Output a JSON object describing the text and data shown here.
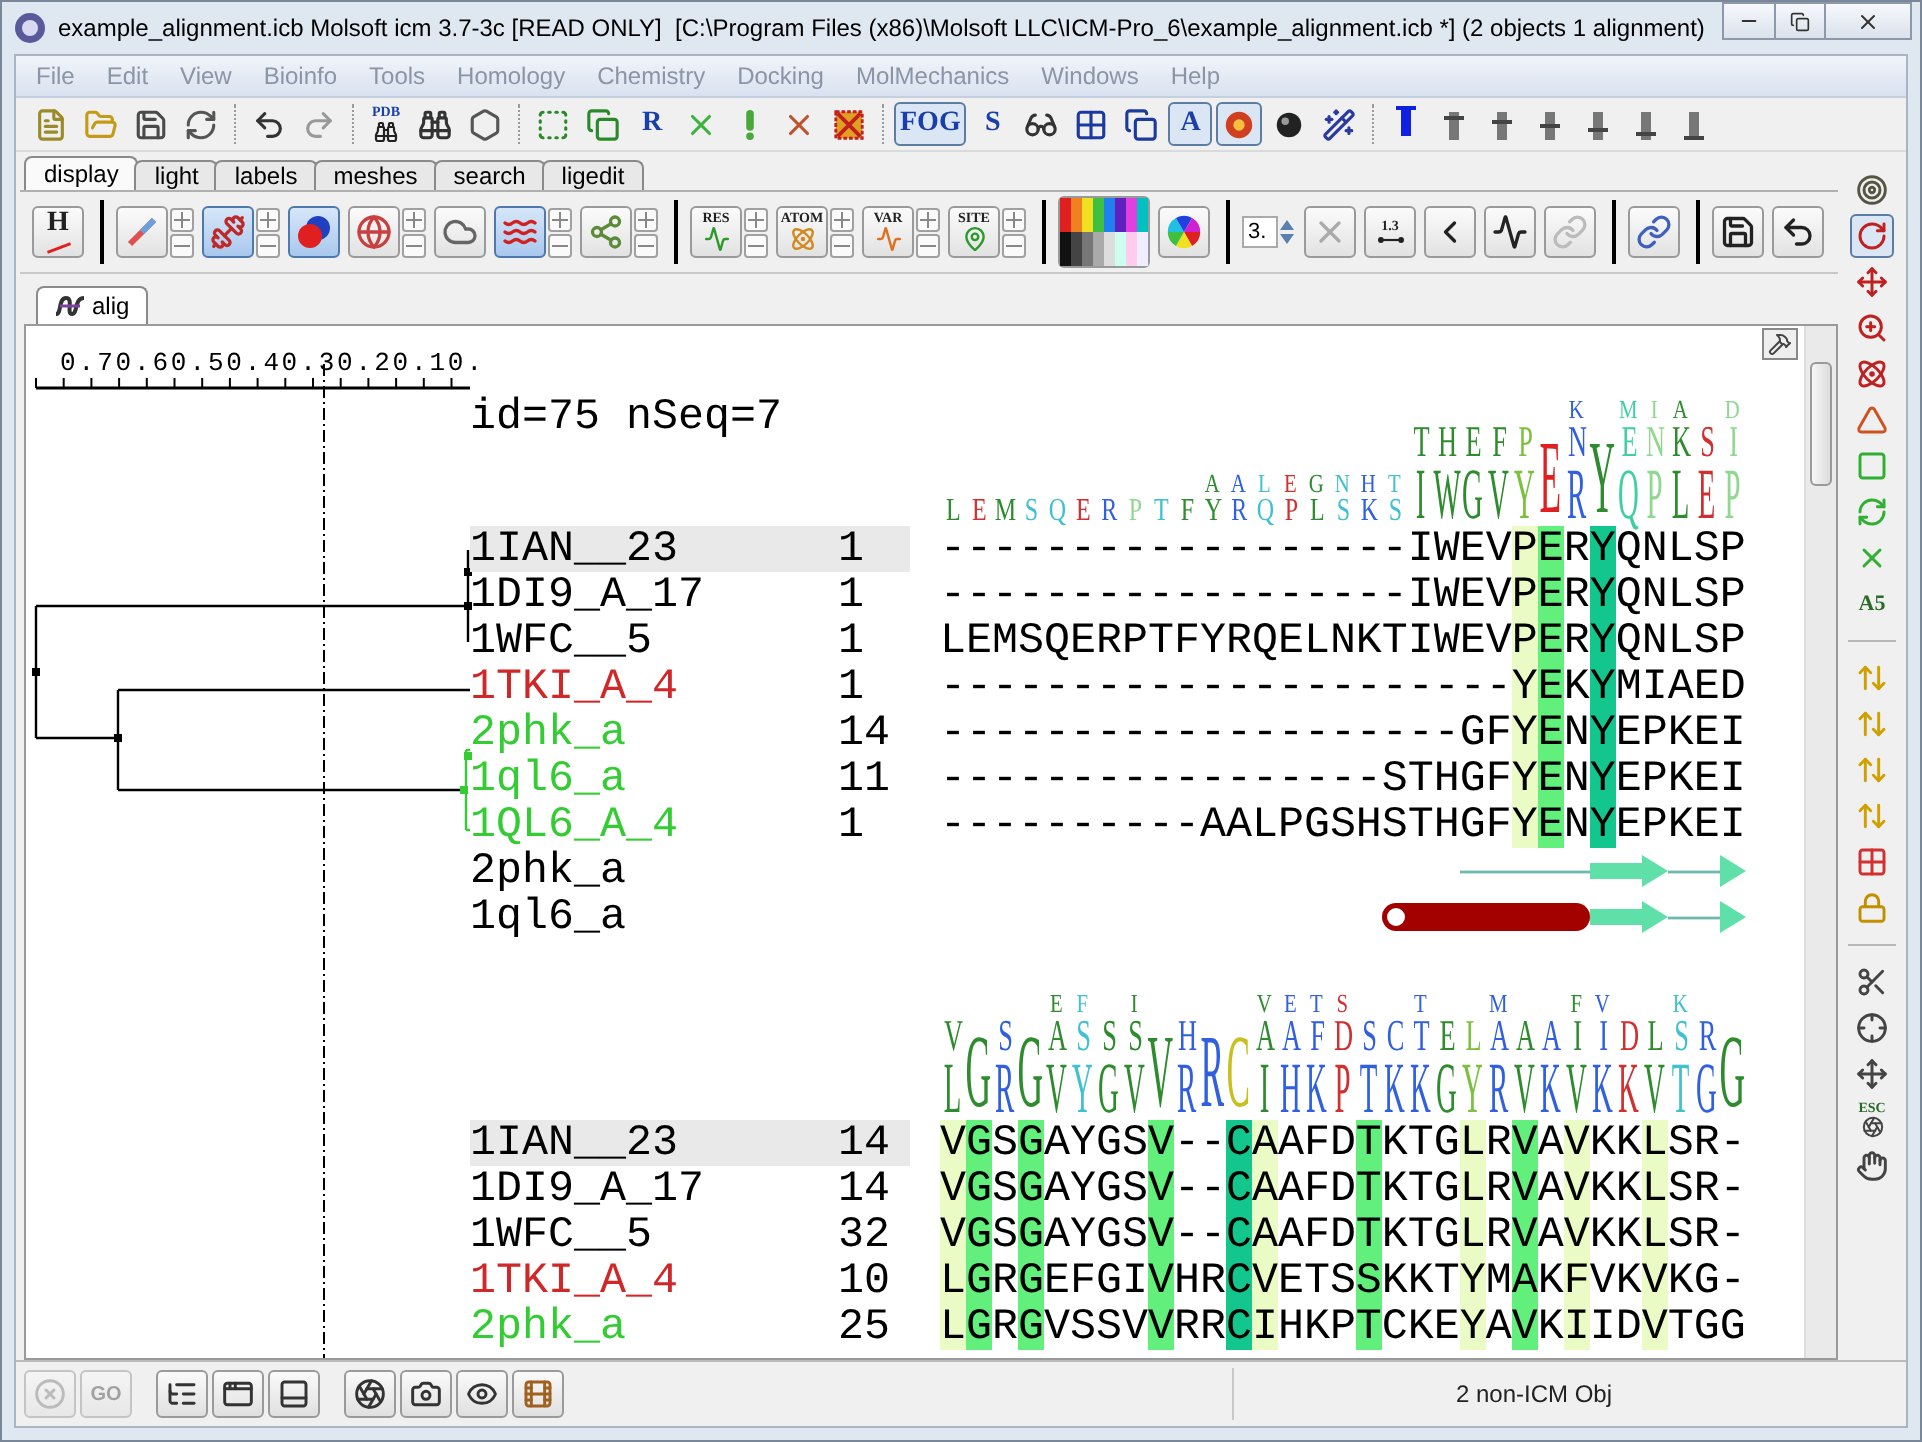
{
  "window": {
    "title": "example_alignment.icb Molsoft icm 3.7-3c [READ ONLY]  [C:\\Program Files (x86)\\Molsoft LLC\\ICM-Pro_6\\example_alignment.icb *] (2 objects 1 alignment)"
  },
  "menu": [
    "File",
    "Edit",
    "View",
    "Bioinfo",
    "Tools",
    "Homology",
    "Chemistry",
    "Docking",
    "MolMechanics",
    "Windows",
    "Help"
  ],
  "main_toolbar": [
    [
      {
        "on": false
      },
      {
        "on": false
      },
      {
        "on": false
      },
      {
        "on": false
      }
    ],
    [
      {
        "on": false
      },
      {
        "on": false
      }
    ],
    [
      {
        "label": "PDB",
        "on": false
      },
      {
        "on": false
      },
      {
        "on": false
      }
    ],
    [
      {
        "on": false
      },
      {
        "on": false
      },
      {
        "label": "R",
        "on": false
      },
      {
        "on": false
      },
      {
        "on": false
      },
      {
        "on": false
      },
      {
        "on": false
      }
    ],
    [
      {
        "label": "FOG",
        "on": true
      },
      {
        "label": "S",
        "on": false
      },
      {
        "on": false
      },
      {
        "on": false
      },
      {
        "on": false
      },
      {
        "label": "A",
        "on": true
      },
      {
        "on": true
      },
      {
        "on": false
      },
      {
        "on": false
      }
    ],
    [
      {
        "on": true
      },
      {
        "on": false
      },
      {
        "on": false
      },
      {
        "on": false
      },
      {
        "on": false
      },
      {
        "on": false
      },
      {
        "on": false
      }
    ]
  ],
  "tabs": [
    {
      "label": "display",
      "selected": true
    },
    {
      "label": "light",
      "selected": false
    },
    {
      "label": "labels",
      "selected": false
    },
    {
      "label": "meshes",
      "selected": false
    },
    {
      "label": "search",
      "selected": false
    },
    {
      "label": "ligedit",
      "selected": false
    }
  ],
  "display_toolbar": [
    [
      {
        "kind": "button",
        "label": "H",
        "on": false,
        "steppers": false
      }
    ],
    [
      {
        "kind": "button",
        "on": false,
        "steppers": true
      },
      {
        "kind": "button",
        "on": true,
        "steppers": true
      },
      {
        "kind": "button",
        "on": true,
        "steppers": false
      },
      {
        "kind": "button",
        "on": false,
        "steppers": true
      },
      {
        "kind": "button",
        "on": false,
        "steppers": false
      },
      {
        "kind": "button",
        "on": true,
        "steppers": true
      },
      {
        "kind": "button",
        "on": false,
        "steppers": true
      }
    ],
    [
      {
        "kind": "button",
        "label": "RES",
        "on": false,
        "steppers": true
      },
      {
        "kind": "button",
        "label": "ATOM",
        "on": false,
        "steppers": true
      },
      {
        "kind": "button",
        "label": "VAR",
        "on": false,
        "steppers": true
      },
      {
        "kind": "button",
        "label": "SITE",
        "on": false,
        "steppers": true
      }
    ],
    [
      {
        "kind": "button",
        "on": false,
        "steppers": false
      },
      {
        "kind": "button",
        "on": false,
        "steppers": false
      }
    ],
    [
      {
        "kind": "spin",
        "value": "3."
      },
      {
        "kind": "button",
        "on": false,
        "steppers": false
      },
      {
        "kind": "button",
        "label": "1.3",
        "on": false,
        "steppers": false
      },
      {
        "kind": "button",
        "on": false,
        "steppers": false
      },
      {
        "kind": "button",
        "on": false,
        "steppers": false
      },
      {
        "kind": "button",
        "on": false,
        "steppers": false
      }
    ],
    [
      {
        "kind": "button",
        "on": false,
        "steppers": false
      }
    ],
    [
      {
        "kind": "button",
        "on": false,
        "steppers": false
      },
      {
        "kind": "button",
        "on": false,
        "steppers": false
      }
    ]
  ],
  "document_tab": {
    "label": "alig",
    "selected": true
  },
  "ruler": {
    "ticks": [
      "0.7",
      "0.6",
      "0.5",
      "0.4",
      "0.3",
      "0.2",
      "0.1",
      "0."
    ]
  },
  "alignment": {
    "header": "id=75 nSeq=7",
    "blocks": [
      {
        "logo": [
          {
            "letters": "L",
            "color": "#2e8b2e",
            "kind": "short"
          },
          {
            "letters": "E",
            "color": "#d03030",
            "kind": "short"
          },
          {
            "letters": "M",
            "color": "#2e8b2e",
            "kind": "short"
          },
          {
            "letters": "S",
            "color": "#40c0d0",
            "kind": "short"
          },
          {
            "letters": "Q",
            "color": "#40c0d0",
            "kind": "short"
          },
          {
            "letters": "E",
            "color": "#d03030",
            "kind": "short"
          },
          {
            "letters": "R",
            "color": "#3060e0",
            "kind": "short"
          },
          {
            "letters": "P",
            "color": "#90d890",
            "kind": "short"
          },
          {
            "letters": "T",
            "color": "#40c0d0",
            "kind": "short"
          },
          {
            "letters": "F",
            "color": "#2e8b2e",
            "kind": "short"
          },
          {
            "letters": "AY",
            "color": "#2e8b2e",
            "kind": "short"
          },
          {
            "letters": "AR",
            "color": "#3060e0",
            "kind": "short"
          },
          {
            "letters": "LQ",
            "color": "#40c0d0",
            "kind": "short"
          },
          {
            "letters": "EP",
            "color": "#d03030",
            "kind": "short"
          },
          {
            "letters": "GL",
            "color": "#2e8b2e",
            "kind": "short"
          },
          {
            "letters": "NS",
            "color": "#40c0d0",
            "kind": "short"
          },
          {
            "letters": "HK",
            "color": "#3060e0",
            "kind": "short"
          },
          {
            "letters": "TS",
            "color": "#40c0d0",
            "kind": "short"
          },
          {
            "letters": "TI",
            "color": "#2e8b2e",
            "kind": "tall"
          },
          {
            "letters": "HW",
            "color": "#2e8b2e",
            "kind": "tall"
          },
          {
            "letters": "EG",
            "color": "#2e8b2e",
            "kind": "tall"
          },
          {
            "letters": "FV",
            "color": "#2e8b2e",
            "kind": "tall"
          },
          {
            "letters": "PY",
            "color": "#7cc040",
            "kind": "tall"
          },
          {
            "letters": "E",
            "color": "#e02020",
            "kind": "tall"
          },
          {
            "letters": "KNR",
            "color": "#3060e0",
            "kind": "tall"
          },
          {
            "letters": "Y",
            "color": "#2e8b2e",
            "kind": "tall"
          },
          {
            "letters": "MEQ",
            "color": "#40d0a0",
            "kind": "tall"
          },
          {
            "letters": "INP",
            "color": "#90d890",
            "kind": "tall"
          },
          {
            "letters": "AKL",
            "color": "#2e8b2e",
            "kind": "tall"
          },
          {
            "letters": "SE",
            "color": "#d03030",
            "kind": "tall"
          },
          {
            "letters": "DIP",
            "color": "#90d890",
            "kind": "tall"
          }
        ],
        "columns": [
          {
            "kind": "none"
          },
          {
            "kind": "none"
          },
          {
            "kind": "none"
          },
          {
            "kind": "none"
          },
          {
            "kind": "none"
          },
          {
            "kind": "none"
          },
          {
            "kind": "none"
          },
          {
            "kind": "none"
          },
          {
            "kind": "none"
          },
          {
            "kind": "none"
          },
          {
            "kind": "none"
          },
          {
            "kind": "none"
          },
          {
            "kind": "none"
          },
          {
            "kind": "none"
          },
          {
            "kind": "none"
          },
          {
            "kind": "none"
          },
          {
            "kind": "none"
          },
          {
            "kind": "none"
          },
          {
            "kind": "none"
          },
          {
            "kind": "none"
          },
          {
            "kind": "none"
          },
          {
            "kind": "none"
          },
          {
            "kind": "light"
          },
          {
            "kind": "green"
          },
          {
            "kind": "none"
          },
          {
            "kind": "teal"
          },
          {
            "kind": "none"
          },
          {
            "kind": "none"
          },
          {
            "kind": "none"
          },
          {
            "kind": "none"
          },
          {
            "kind": "none"
          }
        ],
        "rows": [
          {
            "name": "1IAN__23",
            "start": "1",
            "sequence": "------------------IWEVPERYQNLSP",
            "color": "#000000",
            "selected": true
          },
          {
            "name": "1DI9_A_17",
            "start": "1",
            "sequence": "------------------IWEVPERYQNLSP",
            "color": "#000000",
            "selected": false
          },
          {
            "name": "1WFC__5",
            "start": "1",
            "sequence": "LEMSQERPTFYRQELNKTIWEVPERYQNLSP",
            "color": "#000000",
            "selected": false
          },
          {
            "name": "1TKI_A_4",
            "start": "1",
            "sequence": "----------------------YEKYMIAED",
            "color": "#d02828",
            "selected": false
          },
          {
            "name": "2phk_a",
            "start": "14",
            "sequence": "--------------------GFYENYEPKEI",
            "color": "#33cc33",
            "selected": false
          },
          {
            "name": "1ql6_a",
            "start": "11",
            "sequence": "-----------------STHGFYENYEPKEI",
            "color": "#33cc33",
            "selected": false
          },
          {
            "name": "1QL6_A_4",
            "start": "1",
            "sequence": "----------AALPGSHSTHGFYENYEPKEI",
            "color": "#33cc33",
            "selected": false
          }
        ],
        "structure_rows": [
          {
            "name": "2phk_a",
            "segments": [
              {
                "kind": "none"
              },
              {
                "kind": "none"
              },
              {
                "kind": "none"
              },
              {
                "kind": "none"
              },
              {
                "kind": "none"
              },
              {
                "kind": "none"
              },
              {
                "kind": "none"
              },
              {
                "kind": "none"
              },
              {
                "kind": "none"
              },
              {
                "kind": "none"
              },
              {
                "kind": "none"
              },
              {
                "kind": "none"
              },
              {
                "kind": "none"
              },
              {
                "kind": "none"
              },
              {
                "kind": "none"
              },
              {
                "kind": "none"
              },
              {
                "kind": "none"
              },
              {
                "kind": "none"
              },
              {
                "kind": "none"
              },
              {
                "kind": "none"
              },
              {
                "kind": "coil"
              },
              {
                "kind": "coil"
              },
              {
                "kind": "coil"
              },
              {
                "kind": "coil"
              },
              {
                "kind": "coil"
              },
              {
                "kind": "strand"
              },
              {
                "kind": "strand"
              },
              {
                "kind": "strand"
              },
              {
                "kind": "coil"
              },
              {
                "kind": "coil"
              },
              {
                "kind": "strand"
              }
            ]
          },
          {
            "name": "1ql6_a",
            "segments": [
              {
                "kind": "none"
              },
              {
                "kind": "none"
              },
              {
                "kind": "none"
              },
              {
                "kind": "none"
              },
              {
                "kind": "none"
              },
              {
                "kind": "none"
              },
              {
                "kind": "none"
              },
              {
                "kind": "none"
              },
              {
                "kind": "none"
              },
              {
                "kind": "none"
              },
              {
                "kind": "none"
              },
              {
                "kind": "none"
              },
              {
                "kind": "none"
              },
              {
                "kind": "none"
              },
              {
                "kind": "none"
              },
              {
                "kind": "none"
              },
              {
                "kind": "none"
              },
              {
                "kind": "helix"
              },
              {
                "kind": "helix"
              },
              {
                "kind": "helix"
              },
              {
                "kind": "helix"
              },
              {
                "kind": "helix"
              },
              {
                "kind": "helix"
              },
              {
                "kind": "helix"
              },
              {
                "kind": "helix"
              },
              {
                "kind": "strand"
              },
              {
                "kind": "strand"
              },
              {
                "kind": "strand"
              },
              {
                "kind": "coil"
              },
              {
                "kind": "coil"
              },
              {
                "kind": "strand"
              }
            ]
          }
        ]
      },
      {
        "logo": [
          {
            "letters": "VL",
            "color": "#2e8b2e",
            "kind": "tall"
          },
          {
            "letters": "G",
            "color": "#2e8b2e",
            "kind": "tall"
          },
          {
            "letters": "SR",
            "color": "#3060e0",
            "kind": "tall"
          },
          {
            "letters": "G",
            "color": "#2e8b2e",
            "kind": "tall"
          },
          {
            "letters": "EAV",
            "color": "#2e8b2e",
            "kind": "tall"
          },
          {
            "letters": "FSY",
            "color": "#40c0d0",
            "kind": "tall"
          },
          {
            "letters": "SG",
            "color": "#2e8b2e",
            "kind": "tall"
          },
          {
            "letters": "ISV",
            "color": "#2e8b2e",
            "kind": "tall"
          },
          {
            "letters": "V",
            "color": "#2e8b2e",
            "kind": "tall"
          },
          {
            "letters": "HR",
            "color": "#3060e0",
            "kind": "tall"
          },
          {
            "letters": "R",
            "color": "#3060e0",
            "kind": "tall"
          },
          {
            "letters": "C",
            "color": "#c8c020",
            "kind": "tall"
          },
          {
            "letters": "VAI",
            "color": "#2e8b2e",
            "kind": "tall"
          },
          {
            "letters": "EAH",
            "color": "#3060e0",
            "kind": "tall"
          },
          {
            "letters": "TFK",
            "color": "#3060e0",
            "kind": "tall"
          },
          {
            "letters": "SDP",
            "color": "#d03030",
            "kind": "tall"
          },
          {
            "letters": "ST",
            "color": "#3060e0",
            "kind": "tall"
          },
          {
            "letters": "CK",
            "color": "#3060e0",
            "kind": "tall"
          },
          {
            "letters": "TTK",
            "color": "#3060e0",
            "kind": "tall"
          },
          {
            "letters": "EG",
            "color": "#2e8b2e",
            "kind": "tall"
          },
          {
            "letters": "LY",
            "color": "#7cc040",
            "kind": "tall"
          },
          {
            "letters": "MAR",
            "color": "#3060e0",
            "kind": "tall"
          },
          {
            "letters": "AV",
            "color": "#2e8b2e",
            "kind": "tall"
          },
          {
            "letters": "AK",
            "color": "#3060e0",
            "kind": "tall"
          },
          {
            "letters": "FIV",
            "color": "#2e8b2e",
            "kind": "tall"
          },
          {
            "letters": "VIK",
            "color": "#3060e0",
            "kind": "tall"
          },
          {
            "letters": "DK",
            "color": "#d03030",
            "kind": "tall"
          },
          {
            "letters": "LV",
            "color": "#2e8b2e",
            "kind": "tall"
          },
          {
            "letters": "KST",
            "color": "#40c0d0",
            "kind": "tall"
          },
          {
            "letters": "RG",
            "color": "#3060e0",
            "kind": "tall"
          },
          {
            "letters": "G",
            "color": "#2e8b2e",
            "kind": "tall"
          }
        ],
        "columns": [
          {
            "kind": "light"
          },
          {
            "kind": "green"
          },
          {
            "kind": "none"
          },
          {
            "kind": "green"
          },
          {
            "kind": "none"
          },
          {
            "kind": "none"
          },
          {
            "kind": "none"
          },
          {
            "kind": "none"
          },
          {
            "kind": "green"
          },
          {
            "kind": "none"
          },
          {
            "kind": "none"
          },
          {
            "kind": "teal"
          },
          {
            "kind": "light"
          },
          {
            "kind": "none"
          },
          {
            "kind": "none"
          },
          {
            "kind": "none"
          },
          {
            "kind": "green"
          },
          {
            "kind": "none"
          },
          {
            "kind": "none"
          },
          {
            "kind": "none"
          },
          {
            "kind": "light"
          },
          {
            "kind": "none"
          },
          {
            "kind": "green"
          },
          {
            "kind": "none"
          },
          {
            "kind": "light"
          },
          {
            "kind": "none"
          },
          {
            "kind": "none"
          },
          {
            "kind": "light"
          },
          {
            "kind": "none"
          },
          {
            "kind": "none"
          },
          {
            "kind": "none"
          }
        ],
        "rows": [
          {
            "name": "1IAN__23",
            "start": "14",
            "sequence": "VGSGAYGSV--CAAFDTKTGLRVAVKKLSR-",
            "color": "#000000",
            "selected": true
          },
          {
            "name": "1DI9_A_17",
            "start": "14",
            "sequence": "VGSGAYGSV--CAAFDTKTGLRVAVKKLSR-",
            "color": "#000000",
            "selected": false
          },
          {
            "name": "1WFC__5",
            "start": "32",
            "sequence": "VGSGAYGSV--CAAFDTKTGLRVAVKKLSR-",
            "color": "#000000",
            "selected": false
          },
          {
            "name": "1TKI_A_4",
            "start": "10",
            "sequence": "LGRGEFGIVHRCVETSSKKTYMAKFVKVKG-",
            "color": "#d02828",
            "selected": false
          },
          {
            "name": "2phk_a",
            "start": "25",
            "sequence": "LGRGVSSVVRRCIHKPTCKEYAVKIIDVTGG",
            "color": "#33cc33",
            "selected": false
          }
        ]
      }
    ]
  },
  "right_toolbar": [
    [
      {
        "on": false
      },
      {
        "on": true
      },
      {
        "on": false
      },
      {
        "on": false
      },
      {
        "on": false
      },
      {
        "on": false
      },
      {
        "on": false
      },
      {
        "on": false
      },
      {
        "on": false
      },
      {
        "label": "A5",
        "on": false
      }
    ],
    [
      {
        "on": false
      },
      {
        "on": false
      },
      {
        "on": false
      },
      {
        "on": false
      },
      {
        "on": false
      },
      {
        "on": false
      }
    ],
    [
      {
        "on": false
      },
      {
        "on": false
      },
      {
        "on": false
      },
      {
        "label": "ESC",
        "on": false
      },
      {
        "on": false
      }
    ]
  ],
  "bottom_toolbar": [
    [
      {
        "disabled": true
      },
      {
        "label": "GO",
        "disabled": true
      }
    ],
    [
      {
        "disabled": false
      },
      {
        "disabled": false
      },
      {
        "disabled": false
      }
    ],
    [
      {
        "disabled": false
      },
      {
        "disabled": false
      },
      {
        "disabled": false
      },
      {
        "disabled": false
      }
    ]
  ],
  "status_bar": {
    "text": "2 non-ICM Obj"
  }
}
